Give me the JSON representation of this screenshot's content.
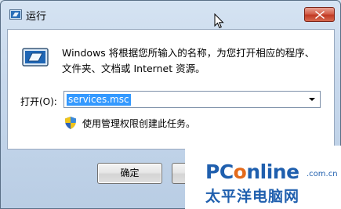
{
  "window": {
    "title": "运行",
    "description": "Windows 将根据您所输入的名称，为您打开相应的程序、文件夹、文档或 Internet 资源。",
    "open_label": "打开(O):",
    "open_value": "services.msc",
    "admin_note": "使用管理权限创建此任务。"
  },
  "buttons": {
    "ok": "确定",
    "cancel": ""
  },
  "watermark": {
    "brand_prefix": "PC",
    "brand_o": "o",
    "brand_suffix": "nline",
    "domain": ".com.cn",
    "chinese": "太平洋电脑网"
  },
  "icons": [
    "run-app-icon",
    "close-icon",
    "shield-icon",
    "dropdown-arrow-icon",
    "mouse-cursor-icon"
  ],
  "colors": {
    "selection": "#3399ff",
    "close_button": "#c13a24",
    "watermark_blue": "#1f5fae",
    "watermark_orange": "#e46b1c"
  }
}
